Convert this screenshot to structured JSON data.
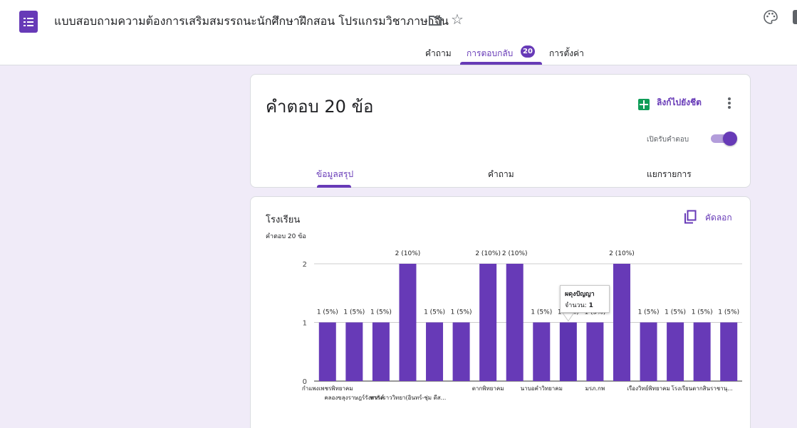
{
  "header": {
    "title": "แบบสอบถามความต้องการเสริมสมรรถนะนักศึกษาฝึกสอน โปรแกรมวิชาภาษาจีน",
    "app_icon": "forms-icon",
    "icons": [
      "folder-icon",
      "star-icon",
      "palette-icon"
    ]
  },
  "top_tabs": {
    "questions": "คำถาม",
    "responses": "การตอบกลับ",
    "responses_badge": "20",
    "settings": "การตั้งค่า",
    "active": "responses"
  },
  "summary_card": {
    "title": "คำตอบ 20 ข้อ",
    "link_sheets": "ลิงก์ไปยังชีต",
    "accepting_label": "เปิดรับคำตอบ",
    "accepting": true,
    "tabs": {
      "summary": "ข้อมูลสรุป",
      "question": "คำถาม",
      "individual": "แยกรายการ"
    },
    "active_tab": "summary"
  },
  "question_card": {
    "title": "โรงเรียน",
    "response_count": "คำตอบ 20 ข้อ",
    "copy_label": "คัดลอก"
  },
  "tooltip": {
    "name": "ผดุงปัญญา",
    "label": "จำนวน: ",
    "value": "1"
  },
  "colors": {
    "accent": "#673ab7",
    "bar": "#673ab7",
    "sheets": "#0f9d58",
    "background": "#f0ebf8"
  },
  "chart_data": {
    "type": "bar",
    "title": "",
    "xlabel": "",
    "ylabel": "",
    "ylim": [
      0,
      2
    ],
    "yticks": [
      "0",
      "1",
      "2"
    ],
    "values": [
      1,
      1,
      1,
      2,
      1,
      1,
      2,
      2,
      1,
      1,
      1,
      2,
      1,
      1,
      1,
      1
    ],
    "bar_labels": [
      "1 (5%)",
      "1 (5%)",
      "1 (5%)",
      "2 (10%)",
      "1 (5%)",
      "1 (5%)",
      "2 (10%)",
      "2 (10%)",
      "1 (5%)",
      "1 (5%)",
      "1 (5%)",
      "2 (10%)",
      "1 (5%)",
      "1 (5%)",
      "1 (5%)",
      "1 (5%)"
    ],
    "x_tick_labels": [
      {
        "bar": 0,
        "text": "กำแพงเพชรพิทยาคม"
      },
      {
        "bar": 1,
        "text": "คลองขลุงราษฎร์รังสรรค์"
      },
      {
        "bar": 3,
        "text": "ชากังราววิทยา(อินทร์-ชุ่ม ดีส..."
      },
      {
        "bar": 6,
        "text": "ตากพิทยาคม"
      },
      {
        "bar": 8,
        "text": "นาบอคำวิทยาคม"
      },
      {
        "bar": 10,
        "text": "มรภ.กพ"
      },
      {
        "bar": 12,
        "text": "เรืองวิทย์พิทยาคม"
      },
      {
        "bar": 14,
        "text": "โรงเรียนตากสินราชานุ..."
      }
    ],
    "grid": true,
    "highlighted_bar": 9
  }
}
